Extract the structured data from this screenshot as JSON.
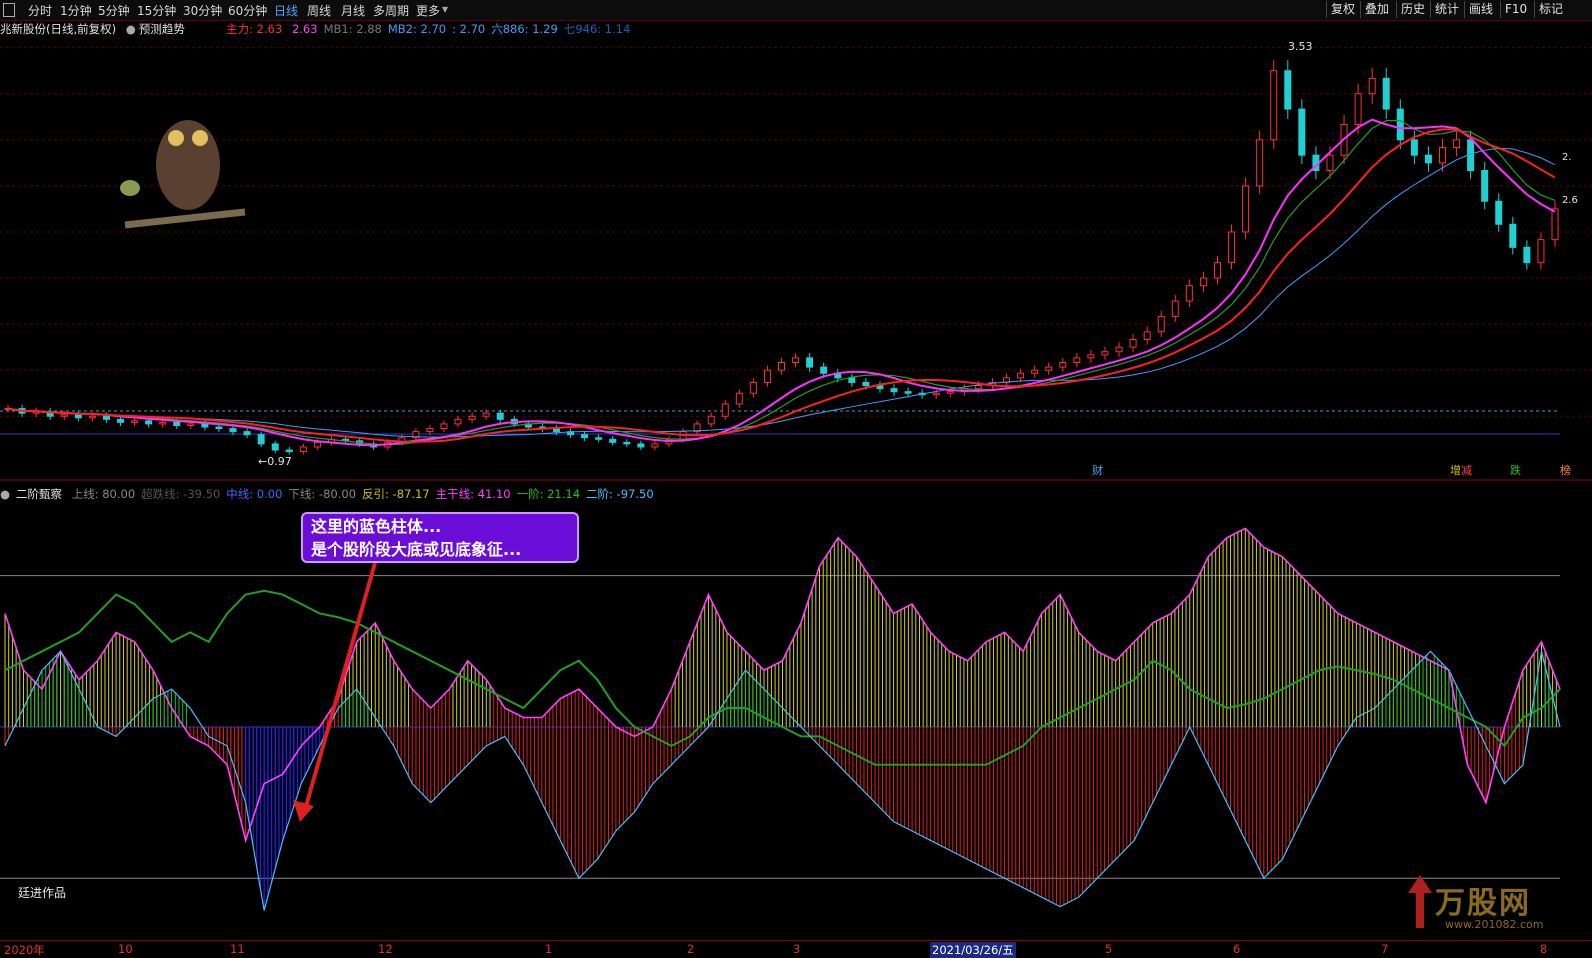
{
  "toolbar": {
    "tabs": [
      "分时",
      "1分钟",
      "5分钟",
      "15分钟",
      "30分钟",
      "60分钟",
      "日线",
      "周线",
      "月线",
      "多周期",
      "更多"
    ],
    "active": "日线",
    "right_buttons": [
      "复权",
      "叠加",
      "历史",
      "统计",
      "画线",
      "F10",
      "标记"
    ]
  },
  "main_header": {
    "stock": "兆新股份(日线,前复权)",
    "forecast": "预测趋势",
    "items": [
      {
        "label": "主力:",
        "value": "2.63",
        "color": "#ff3030"
      },
      {
        "label": "",
        "value": "2.63",
        "color": "#ff40ff"
      },
      {
        "label": "MB1:",
        "value": "2.88",
        "color": "#777777"
      },
      {
        "label": "MB2:",
        "value": "2.70",
        "color": "#3aa0ff"
      },
      {
        "label": ":",
        "value": "2.70",
        "color": "#3aa0ff"
      },
      {
        "label": "六886:",
        "value": "1.29",
        "color": "#3aa0ff"
      },
      {
        "label": "七946:",
        "value": "1.14",
        "color": "#1a60c0"
      }
    ]
  },
  "price_labels": {
    "high": "3.53",
    "low": "0.97",
    "right1": "2.",
    "right2": "2.6"
  },
  "markers": {
    "cai": "财",
    "zeng": "增",
    "jian": "减",
    "die": "跌",
    "fang": "榜"
  },
  "indicator": {
    "name": "二阶甄察",
    "items": [
      {
        "label": "上线:",
        "value": "80.00",
        "color": "#888888"
      },
      {
        "label": "超跌线:",
        "value": "-39.50",
        "color": "#555555"
      },
      {
        "label": "中线:",
        "value": "0.00",
        "color": "#3a6bff"
      },
      {
        "label": "下线:",
        "value": "-80.00",
        "color": "#888888"
      },
      {
        "label": "反引:",
        "value": "-87.17",
        "color": "#d6c000"
      },
      {
        "label": "主干线:",
        "value": "41.10",
        "color": "#ff40ff"
      },
      {
        "label": "一阶:",
        "value": "21.14",
        "color": "#20c020"
      },
      {
        "label": "二阶:",
        "value": "-97.50",
        "color": "#40c0ff"
      }
    ]
  },
  "callout": {
    "line1": "这里的蓝色柱体...",
    "line2": "是个股阶段大底或见底象征..."
  },
  "author": "廷进作品",
  "watermark": {
    "big": "万股网",
    "small": "www.201082.com"
  },
  "bottom_axis": {
    "labels": [
      "2020年",
      "10",
      "11",
      "12",
      "1",
      "2",
      "3",
      "2021/03/26/五",
      "5",
      "6",
      "7",
      "8"
    ]
  },
  "chart_data": {
    "type": "candlestick",
    "price_ylim": [
      0.85,
      3.65
    ],
    "close": [
      1.25,
      1.22,
      1.23,
      1.2,
      1.21,
      1.19,
      1.2,
      1.18,
      1.16,
      1.17,
      1.15,
      1.16,
      1.14,
      1.15,
      1.13,
      1.12,
      1.1,
      1.08,
      1.02,
      0.98,
      0.97,
      1.0,
      1.03,
      1.05,
      1.04,
      1.02,
      1.0,
      1.03,
      1.06,
      1.1,
      1.12,
      1.15,
      1.18,
      1.2,
      1.22,
      1.18,
      1.15,
      1.13,
      1.12,
      1.1,
      1.08,
      1.06,
      1.05,
      1.03,
      1.02,
      1.0,
      1.02,
      1.05,
      1.1,
      1.15,
      1.2,
      1.28,
      1.35,
      1.42,
      1.5,
      1.55,
      1.58,
      1.52,
      1.48,
      1.45,
      1.42,
      1.4,
      1.38,
      1.36,
      1.35,
      1.34,
      1.35,
      1.36,
      1.38,
      1.4,
      1.42,
      1.45,
      1.48,
      1.5,
      1.52,
      1.55,
      1.58,
      1.6,
      1.62,
      1.65,
      1.7,
      1.75,
      1.85,
      1.95,
      2.05,
      2.1,
      2.2,
      2.4,
      2.7,
      3.0,
      3.45,
      3.2,
      2.9,
      2.8,
      2.9,
      3.1,
      3.3,
      3.4,
      3.2,
      3.0,
      2.9,
      2.85,
      2.95,
      3.0,
      2.8,
      2.6,
      2.45,
      2.3,
      2.2,
      2.35,
      2.55
    ],
    "indicator_ylim": [
      -110,
      120
    ],
    "main_line": [
      60,
      30,
      20,
      40,
      25,
      35,
      50,
      45,
      30,
      10,
      -5,
      -10,
      -20,
      -60,
      -30,
      -25,
      -10,
      0,
      15,
      45,
      55,
      35,
      20,
      10,
      20,
      35,
      25,
      10,
      5,
      5,
      15,
      20,
      10,
      0,
      -5,
      0,
      20,
      45,
      70,
      50,
      40,
      30,
      35,
      55,
      85,
      100,
      90,
      75,
      60,
      65,
      50,
      40,
      35,
      45,
      50,
      40,
      60,
      70,
      50,
      40,
      35,
      45,
      55,
      60,
      70,
      90,
      100,
      105,
      95,
      90,
      80,
      70,
      60,
      55,
      50,
      45,
      40,
      35,
      30,
      -20,
      -40,
      0,
      30,
      45,
      20
    ],
    "first_order": [
      30,
      35,
      40,
      45,
      50,
      60,
      70,
      65,
      55,
      45,
      50,
      45,
      60,
      70,
      72,
      70,
      65,
      60,
      58,
      55,
      50,
      45,
      40,
      35,
      30,
      25,
      20,
      15,
      10,
      20,
      30,
      35,
      25,
      10,
      0,
      -5,
      -10,
      -5,
      5,
      10,
      10,
      5,
      0,
      -5,
      -5,
      -10,
      -15,
      -20,
      -20,
      -20,
      -20,
      -20,
      -20,
      -20,
      -15,
      -10,
      0,
      5,
      10,
      15,
      20,
      25,
      35,
      30,
      20,
      15,
      10,
      12,
      15,
      20,
      25,
      30,
      32,
      30,
      28,
      25,
      20,
      15,
      10,
      5,
      0,
      -10,
      5,
      10,
      20
    ],
    "second_order": [
      -10,
      10,
      30,
      40,
      20,
      0,
      -5,
      5,
      15,
      20,
      10,
      -5,
      -10,
      -40,
      -97,
      -60,
      -30,
      -10,
      10,
      20,
      5,
      -10,
      -30,
      -40,
      -30,
      -20,
      -10,
      -5,
      -20,
      -40,
      -60,
      -80,
      -70,
      -55,
      -45,
      -30,
      -20,
      -10,
      0,
      15,
      30,
      20,
      10,
      0,
      -10,
      -20,
      -30,
      -40,
      -50,
      -55,
      -60,
      -65,
      -70,
      -75,
      -80,
      -85,
      -90,
      -95,
      -90,
      -80,
      -70,
      -60,
      -40,
      -20,
      0,
      -20,
      -40,
      -60,
      -80,
      -70,
      -50,
      -30,
      -10,
      5,
      10,
      20,
      30,
      40,
      30,
      10,
      -10,
      -30,
      -20,
      40,
      0
    ]
  }
}
